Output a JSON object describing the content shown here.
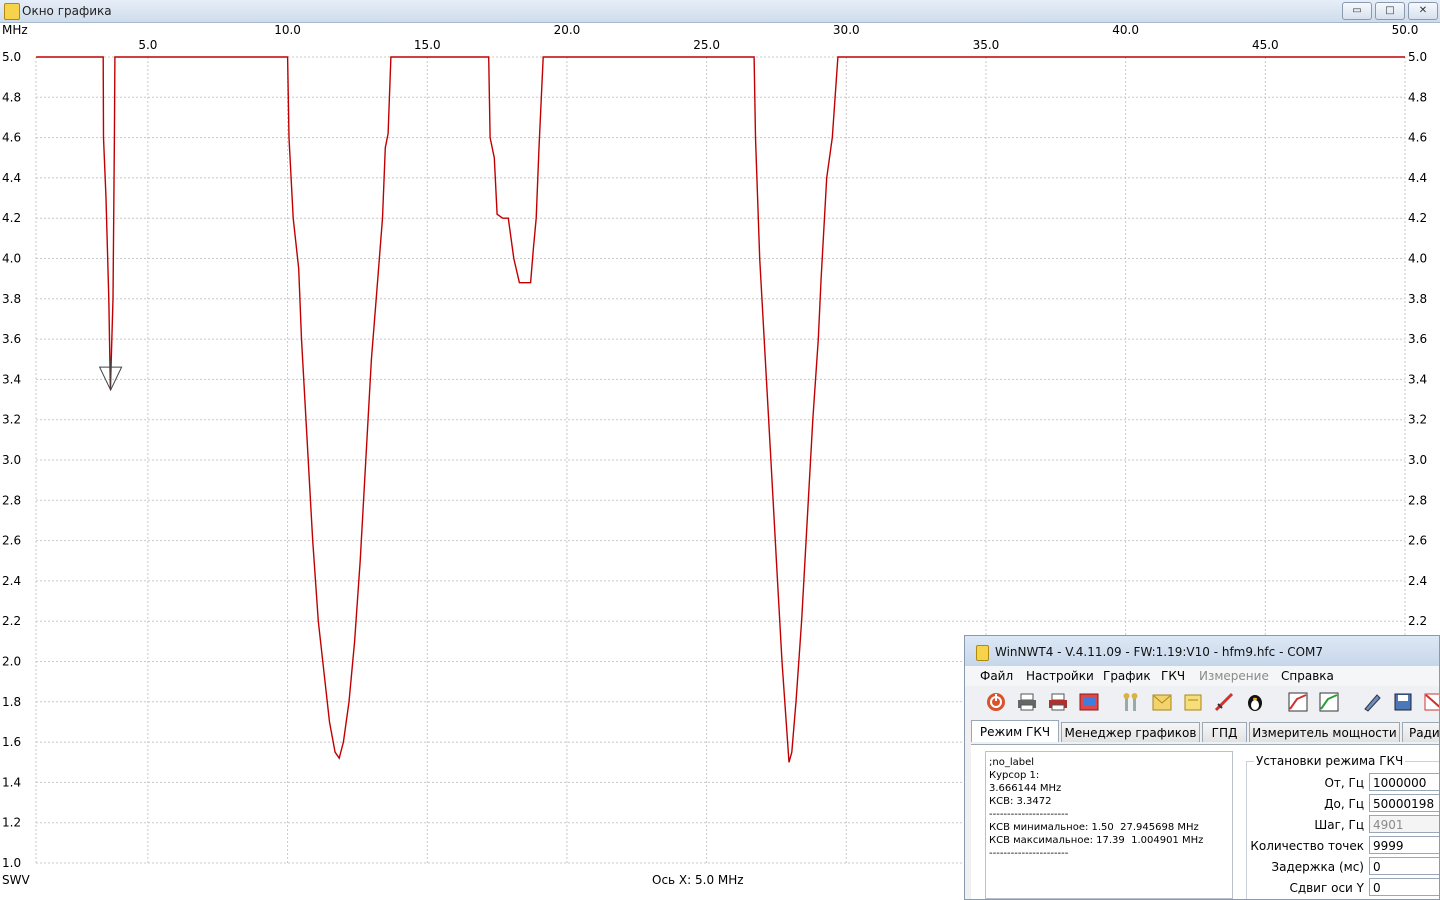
{
  "graph_window": {
    "title": "Окно графика",
    "controls": {
      "minimize": "▭",
      "maximize": "□",
      "close": "✕"
    }
  },
  "chart_data": {
    "type": "line",
    "xunit_label": "MHz",
    "ylabel": "SWV",
    "x_axis_caption": "Ось X: 5.0 MHz",
    "xlim": [
      0.995,
      50.0
    ],
    "ylim": [
      1.0,
      5.0
    ],
    "x_ticks_top": [
      "10.0",
      "20.0",
      "30.0",
      "40.0",
      "50.0"
    ],
    "x_ticks_bottom": [
      "5.0",
      "15.0",
      "25.0",
      "35.0",
      "45.0"
    ],
    "y_ticks": [
      "5.0",
      "4.8",
      "4.6",
      "4.4",
      "4.2",
      "4.0",
      "3.8",
      "3.6",
      "3.4",
      "3.2",
      "3.0",
      "2.8",
      "2.6",
      "2.4",
      "2.2",
      "2.0",
      "1.8",
      "1.6",
      "1.4",
      "1.2",
      "1.0"
    ],
    "cursor": {
      "x": 3.666,
      "y": 3.347
    },
    "series": [
      {
        "color": "#c00000",
        "points": [
          [
            1.0,
            5.0
          ],
          [
            3.4,
            5.0
          ],
          [
            3.41,
            4.6
          ],
          [
            3.5,
            4.3
          ],
          [
            3.6,
            3.8
          ],
          [
            3.66,
            3.35
          ],
          [
            3.75,
            3.8
          ],
          [
            3.8,
            4.6
          ],
          [
            3.82,
            5.0
          ],
          [
            10.0,
            5.0
          ],
          [
            10.05,
            4.6
          ],
          [
            10.2,
            4.2
          ],
          [
            10.4,
            3.95
          ],
          [
            10.5,
            3.6
          ],
          [
            10.7,
            3.1
          ],
          [
            10.9,
            2.6
          ],
          [
            11.1,
            2.2
          ],
          [
            11.3,
            1.95
          ],
          [
            11.5,
            1.7
          ],
          [
            11.7,
            1.55
          ],
          [
            11.85,
            1.52
          ],
          [
            12.0,
            1.6
          ],
          [
            12.2,
            1.8
          ],
          [
            12.4,
            2.1
          ],
          [
            12.6,
            2.5
          ],
          [
            12.8,
            3.0
          ],
          [
            13.0,
            3.5
          ],
          [
            13.2,
            3.85
          ],
          [
            13.4,
            4.2
          ],
          [
            13.5,
            4.55
          ],
          [
            13.6,
            4.62
          ],
          [
            13.7,
            5.0
          ],
          [
            17.2,
            5.0
          ],
          [
            17.25,
            4.6
          ],
          [
            17.4,
            4.5
          ],
          [
            17.5,
            4.22
          ],
          [
            17.7,
            4.2
          ],
          [
            17.9,
            4.2
          ],
          [
            18.1,
            4.0
          ],
          [
            18.3,
            3.88
          ],
          [
            18.7,
            3.88
          ],
          [
            18.8,
            4.05
          ],
          [
            18.9,
            4.2
          ],
          [
            19.0,
            4.55
          ],
          [
            19.15,
            5.0
          ],
          [
            26.7,
            5.0
          ],
          [
            26.75,
            4.6
          ],
          [
            26.9,
            4.0
          ],
          [
            27.1,
            3.5
          ],
          [
            27.3,
            3.0
          ],
          [
            27.5,
            2.5
          ],
          [
            27.7,
            2.0
          ],
          [
            27.85,
            1.7
          ],
          [
            27.95,
            1.5
          ],
          [
            28.05,
            1.55
          ],
          [
            28.2,
            1.8
          ],
          [
            28.4,
            2.2
          ],
          [
            28.6,
            2.7
          ],
          [
            28.8,
            3.2
          ],
          [
            29.0,
            3.6
          ],
          [
            29.1,
            3.9
          ],
          [
            29.3,
            4.4
          ],
          [
            29.5,
            4.6
          ],
          [
            29.6,
            4.8
          ],
          [
            29.7,
            5.0
          ],
          [
            50.0,
            5.0
          ]
        ]
      }
    ]
  },
  "nwt_window": {
    "title": "WinNWT4 - V.4.11.09 - FW:1.19:V10 - hfm9.hfc - COM7",
    "menu": [
      "Файл",
      "Настройки",
      "График",
      "ГКЧ",
      "Измерение",
      "Справка"
    ],
    "toolbar_icons": [
      "power-icon",
      "print-icon",
      "print-color-icon",
      "png-export-icon",
      "tools-icon",
      "folder-icon",
      "note-icon",
      "probe-icon",
      "linux-icon",
      "calibrate-icon",
      "calibrate-green-icon",
      "pen-icon",
      "save-icon",
      "delete-icon"
    ],
    "tabs": [
      "Режим ГКЧ",
      "Менеджер графиков",
      "ГПД",
      "Измеритель мощности",
      "Ради"
    ],
    "info_lines": [
      ";no_label",
      "",
      "Курсор 1:",
      "3.666144 MHz",
      "КСВ: 3.3472",
      "----------------------",
      "КСВ минимальное: 1.50  27.945698 MHz",
      "КСВ максимальное: 17.39  1.004901 MHz",
      "----------------------"
    ],
    "settings": {
      "group_title": "Установки режима ГКЧ",
      "fields": [
        {
          "label": "От, Гц",
          "value": "1000000"
        },
        {
          "label": "До, Гц",
          "value": "50000198"
        },
        {
          "label": "Шаг, Гц",
          "value": "4901"
        },
        {
          "label": "Количество точек",
          "value": "9999"
        },
        {
          "label": "Задержка (мс)",
          "value": "0"
        },
        {
          "label": "Сдвиг оси Y",
          "value": "0"
        }
      ]
    }
  }
}
